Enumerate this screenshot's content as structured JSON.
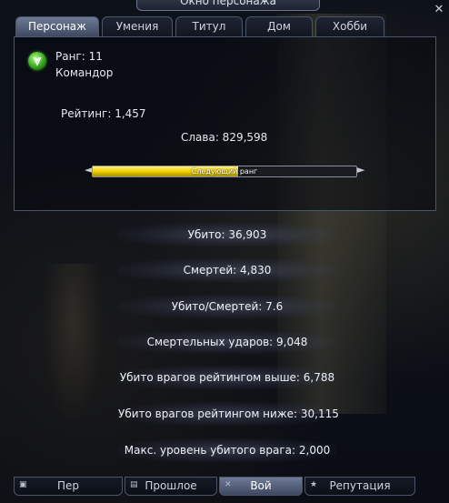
{
  "window": {
    "title": "Окно персонажа"
  },
  "tabs": [
    {
      "label": "Персонаж"
    },
    {
      "label": "Умения"
    },
    {
      "label": "Титул"
    },
    {
      "label": "Дом"
    },
    {
      "label": "Хобби"
    }
  ],
  "profile": {
    "rank_label": "Ранг: 11",
    "rank_title": "Командор",
    "rating_label": "Рейтинг: 1,457",
    "fame_label": "Слава: 829,598",
    "next_rank_label": "Следующий ранг",
    "next_rank_progress": 0.55
  },
  "stats": [
    {
      "text": "Убито: 36,903"
    },
    {
      "text": "Смертей: 4,830"
    },
    {
      "text": "Убито/Смертей: 7.6"
    },
    {
      "text": "Смертельных ударов: 9,048"
    },
    {
      "text": "Убито врагов рейтингом выше: 6,788"
    },
    {
      "text": "Убито врагов рейтингом ниже: 30,115"
    },
    {
      "text": "Макс. уровень убитого врага: 2,000"
    }
  ],
  "bottom_tabs": [
    {
      "label": "Пер",
      "icon": "page-icon"
    },
    {
      "label": "Прошлое",
      "icon": "scroll-icon"
    },
    {
      "label": "Вой",
      "icon": "swords-icon"
    },
    {
      "label": "Репутация",
      "icon": "star-icon"
    }
  ],
  "colors": {
    "accent": "#f0d000",
    "active_tab": "#56627c"
  }
}
